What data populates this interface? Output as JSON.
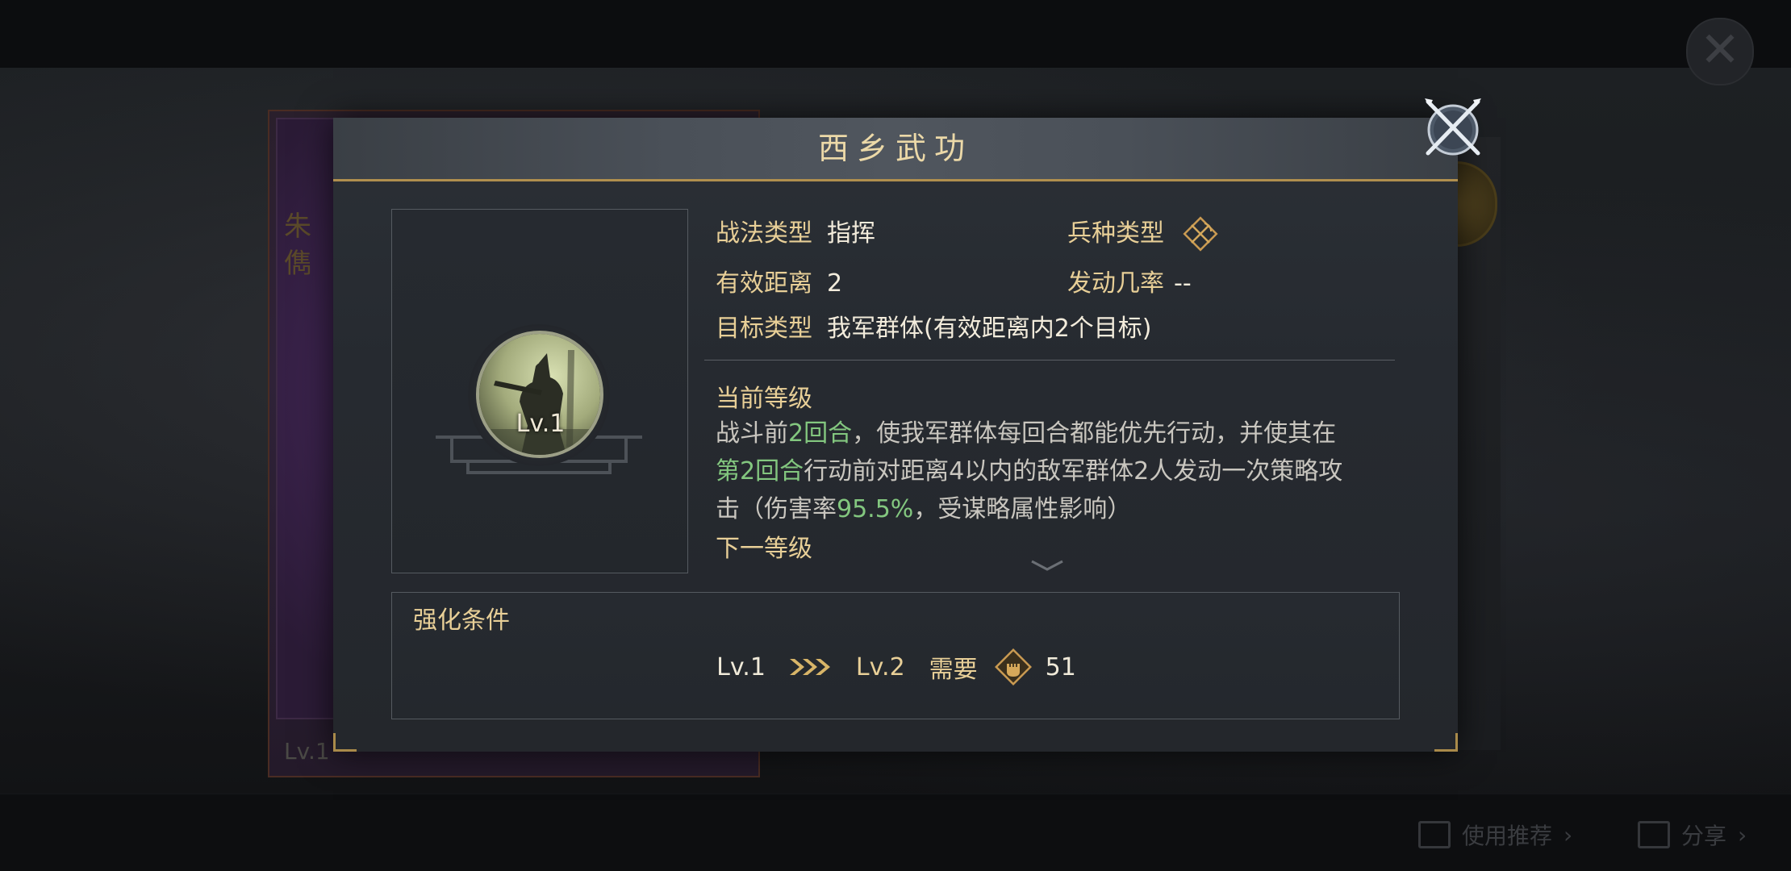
{
  "background": {
    "left_card_name": "朱儁",
    "left_card_level": "Lv.1",
    "bottom_buttons": [
      {
        "label": "使用推荐"
      },
      {
        "label": "分享"
      }
    ]
  },
  "dialog": {
    "title": "西乡武功",
    "skill_level_badge": "Lv.1",
    "attributes": {
      "tactic_type_label": "战法类型",
      "tactic_type_value": "指挥",
      "troop_type_label": "兵种类型",
      "troop_type_icon": "crossed-weapons-diamond-icon",
      "range_label": "有效距离",
      "range_value": "2",
      "trigger_rate_label": "发动几率",
      "trigger_rate_value": "--",
      "target_label": "目标类型",
      "target_value": "我军群体(有效距离内2个目标)"
    },
    "current_level_heading": "当前等级",
    "description": {
      "line1_a": "战斗前",
      "line1_hl": "2回合",
      "line1_b": "，使我军群体每回合都能优先行动，并使其在",
      "line2_hl": "第2回合",
      "line2_b": "行动前对距离4以内的敌军群体2人发动一次策略攻",
      "line3_a": "击（伤害率",
      "line3_hl": "95.5%",
      "line3_b": "，受谋略属性影响）"
    },
    "next_level_heading": "下一等级",
    "upgrade": {
      "label": "强化条件",
      "from_level": "Lv.1",
      "to_level": "Lv.2",
      "requires_label": "需要",
      "cost_icon": "fist-token-icon",
      "cost_value": "51"
    },
    "colors": {
      "gold_text": "#e8cf97",
      "highlight_green": "#83c77f",
      "border_gold": "#b08f4e"
    }
  }
}
